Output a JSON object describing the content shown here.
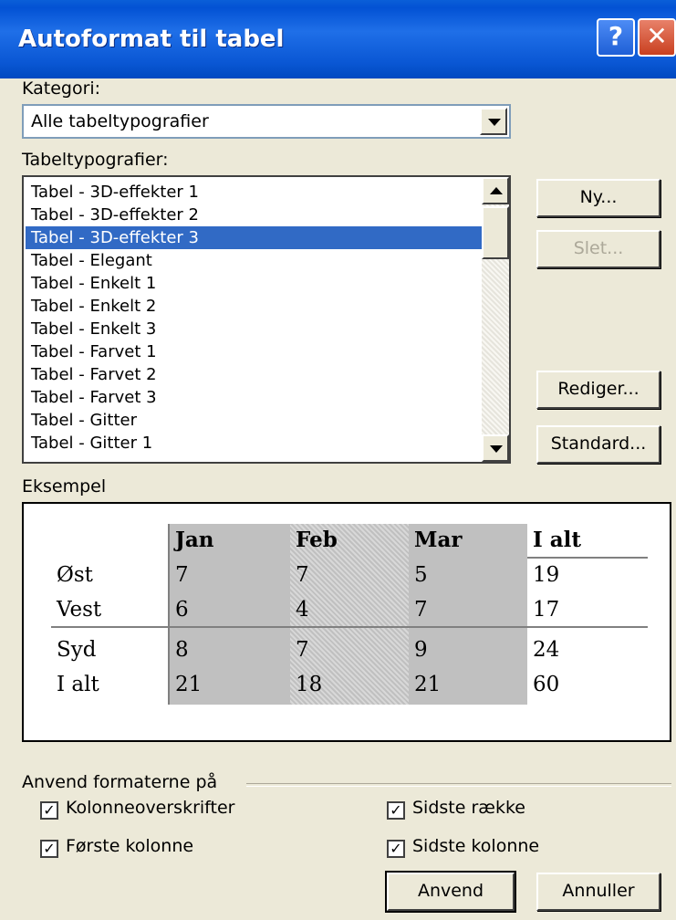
{
  "window": {
    "title": "Autoformat til tabel",
    "help_label": "?",
    "close_label": "✕"
  },
  "category": {
    "label": "Kategori:",
    "value": "Alle tabeltypografier"
  },
  "styles": {
    "label": "Tabeltypografier:",
    "items": [
      "Tabel - 3D-effekter 1",
      "Tabel - 3D-effekter 2",
      "Tabel - 3D-effekter 3",
      "Tabel - Elegant",
      "Tabel - Enkelt 1",
      "Tabel - Enkelt 2",
      "Tabel - Enkelt 3",
      "Tabel - Farvet 1",
      "Tabel - Farvet 2",
      "Tabel - Farvet 3",
      "Tabel - Gitter",
      "Tabel - Gitter 1"
    ],
    "selected_index": 2
  },
  "buttons": {
    "new": "Ny...",
    "delete": "Slet...",
    "edit": "Rediger...",
    "default": "Standard...",
    "apply": "Anvend",
    "cancel": "Annuller"
  },
  "example": {
    "label": "Eksempel",
    "header": [
      "",
      "Jan",
      "Feb",
      "Mar",
      "I alt"
    ],
    "rows": [
      [
        "Øst",
        "7",
        "7",
        "5",
        "19"
      ],
      [
        "Vest",
        "6",
        "4",
        "7",
        "17"
      ],
      [
        "Syd",
        "8",
        "7",
        "9",
        "24"
      ],
      [
        "I alt",
        "21",
        "18",
        "21",
        "60"
      ]
    ]
  },
  "apply_to": {
    "label": "Anvend formaterne på",
    "options": [
      {
        "label": "Kolonneoverskrifter",
        "checked": true
      },
      {
        "label": "Første kolonne",
        "checked": true
      },
      {
        "label": "Sidste række",
        "checked": true
      },
      {
        "label": "Sidste kolonne",
        "checked": true
      }
    ]
  },
  "colors": {
    "selection": "#316ac5",
    "dialog_bg": "#ece9d8",
    "title_blue": "#0a57d4"
  }
}
